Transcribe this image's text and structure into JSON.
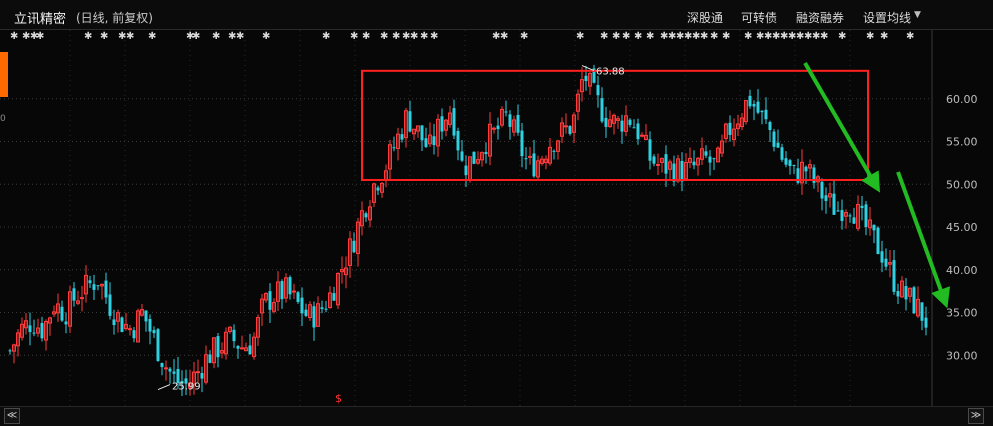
{
  "header": {
    "title": "立讯精密",
    "subtitle": "(日线, 前复权)",
    "buttons": [
      "深股通",
      "可转债",
      "融资融券",
      "设置均线"
    ],
    "caret": "▼"
  },
  "nav": {
    "left": "≪",
    "right": "≫"
  },
  "chart_data": {
    "type": "candlestick",
    "y_axis": {
      "ticks": [
        60,
        55,
        50,
        45,
        40,
        35,
        30
      ],
      "labels": [
        "60.00",
        "55.00",
        "50.00",
        "45.00",
        "40.00",
        "35.00",
        "30.00"
      ],
      "range": [
        25,
        65
      ]
    },
    "annotations": [
      {
        "label": "63.88",
        "value": 63.88,
        "kind": "high"
      },
      {
        "label": "25.99",
        "value": 25.99,
        "kind": "low"
      }
    ],
    "marker": "$",
    "overlays": {
      "range_box": {
        "color": "#ff2020",
        "upper": 63.5,
        "lower": 50.5
      },
      "arrows_color": "#22bb22"
    },
    "series_colors": {
      "up": "#ff3b3b",
      "down": "#2fd0e0"
    },
    "close_path": [
      30.5,
      33,
      34,
      33,
      36,
      35,
      37,
      38,
      39,
      36,
      34,
      33,
      35,
      32,
      29,
      27,
      26.5,
      28,
      30,
      31,
      32,
      31,
      31.5,
      36,
      37,
      37.5,
      36,
      34.5,
      35,
      37,
      40,
      43,
      47,
      50,
      52,
      55,
      58,
      56,
      54,
      57,
      59,
      52,
      53,
      55,
      56,
      58,
      55,
      52,
      53,
      55,
      56,
      57,
      63,
      60,
      58,
      57,
      58,
      56,
      53,
      52,
      52,
      51.5,
      52,
      53,
      52,
      56,
      58,
      60,
      58,
      56,
      53,
      51,
      52,
      50,
      48,
      47,
      48,
      46,
      44,
      42,
      39,
      37,
      36,
      34
    ]
  }
}
